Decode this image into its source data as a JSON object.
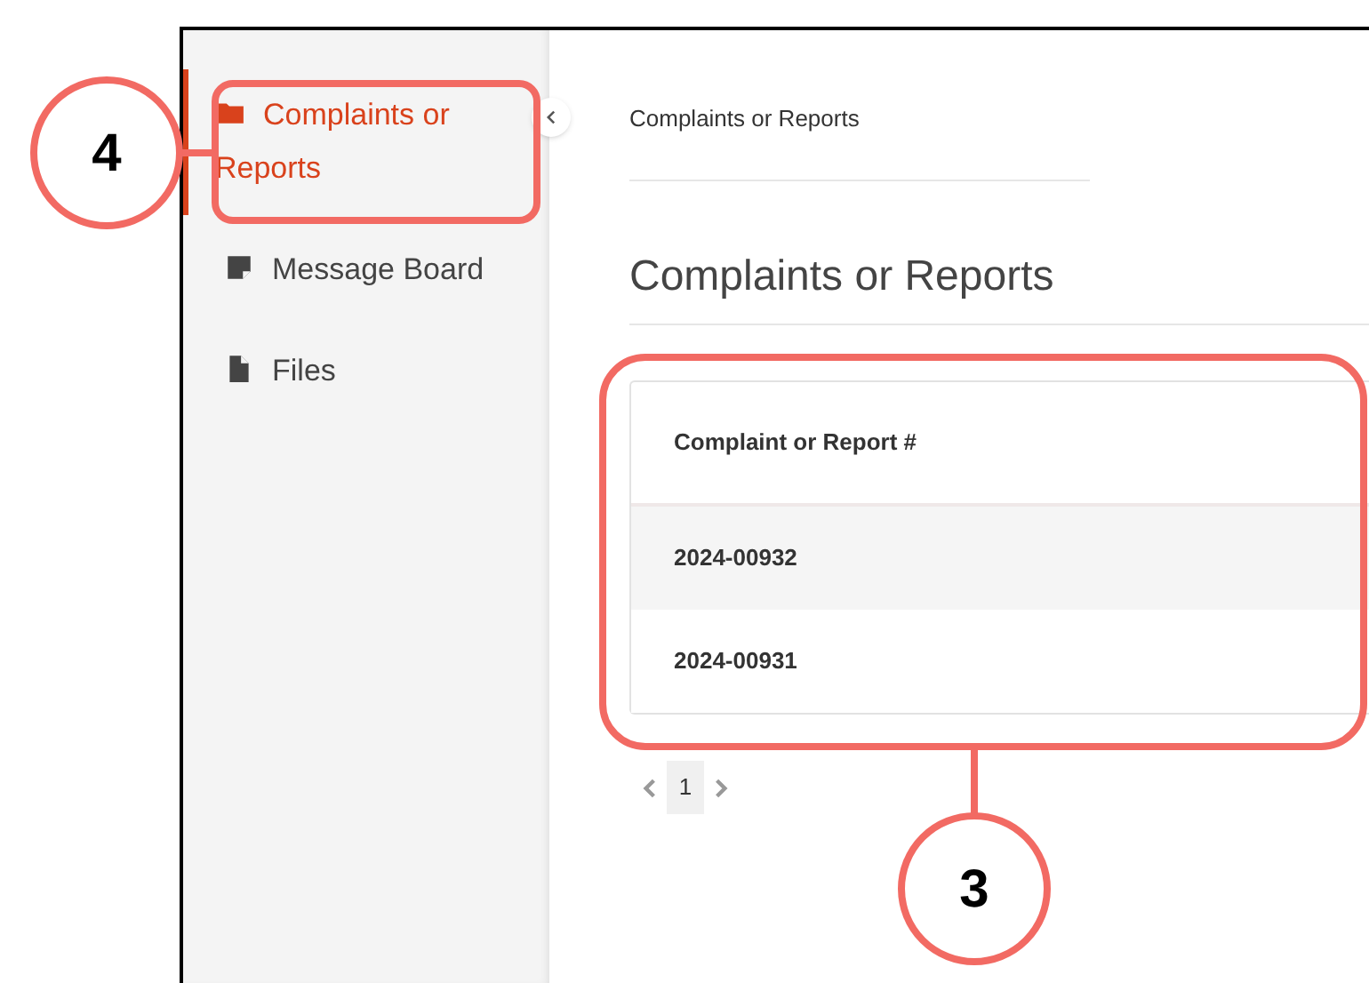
{
  "sidebar": {
    "items": [
      {
        "kind": "folder",
        "label": "Complaints or Reports",
        "selected": true
      },
      {
        "kind": "note",
        "label": "Message Board",
        "selected": false
      },
      {
        "kind": "file",
        "label": "Files",
        "selected": false
      }
    ]
  },
  "breadcrumb": "Complaints or Reports",
  "heading": "Complaints or Reports",
  "table": {
    "columns": [
      "Complaint or Report #"
    ],
    "rows": [
      [
        "2024-00932"
      ],
      [
        "2024-00931"
      ]
    ]
  },
  "pagination": {
    "pages": [
      {
        "label": "1",
        "selected": true
      }
    ]
  },
  "callouts": [
    {
      "number": "4",
      "kind": "sidebar"
    },
    {
      "number": "3",
      "kind": "table"
    }
  ]
}
